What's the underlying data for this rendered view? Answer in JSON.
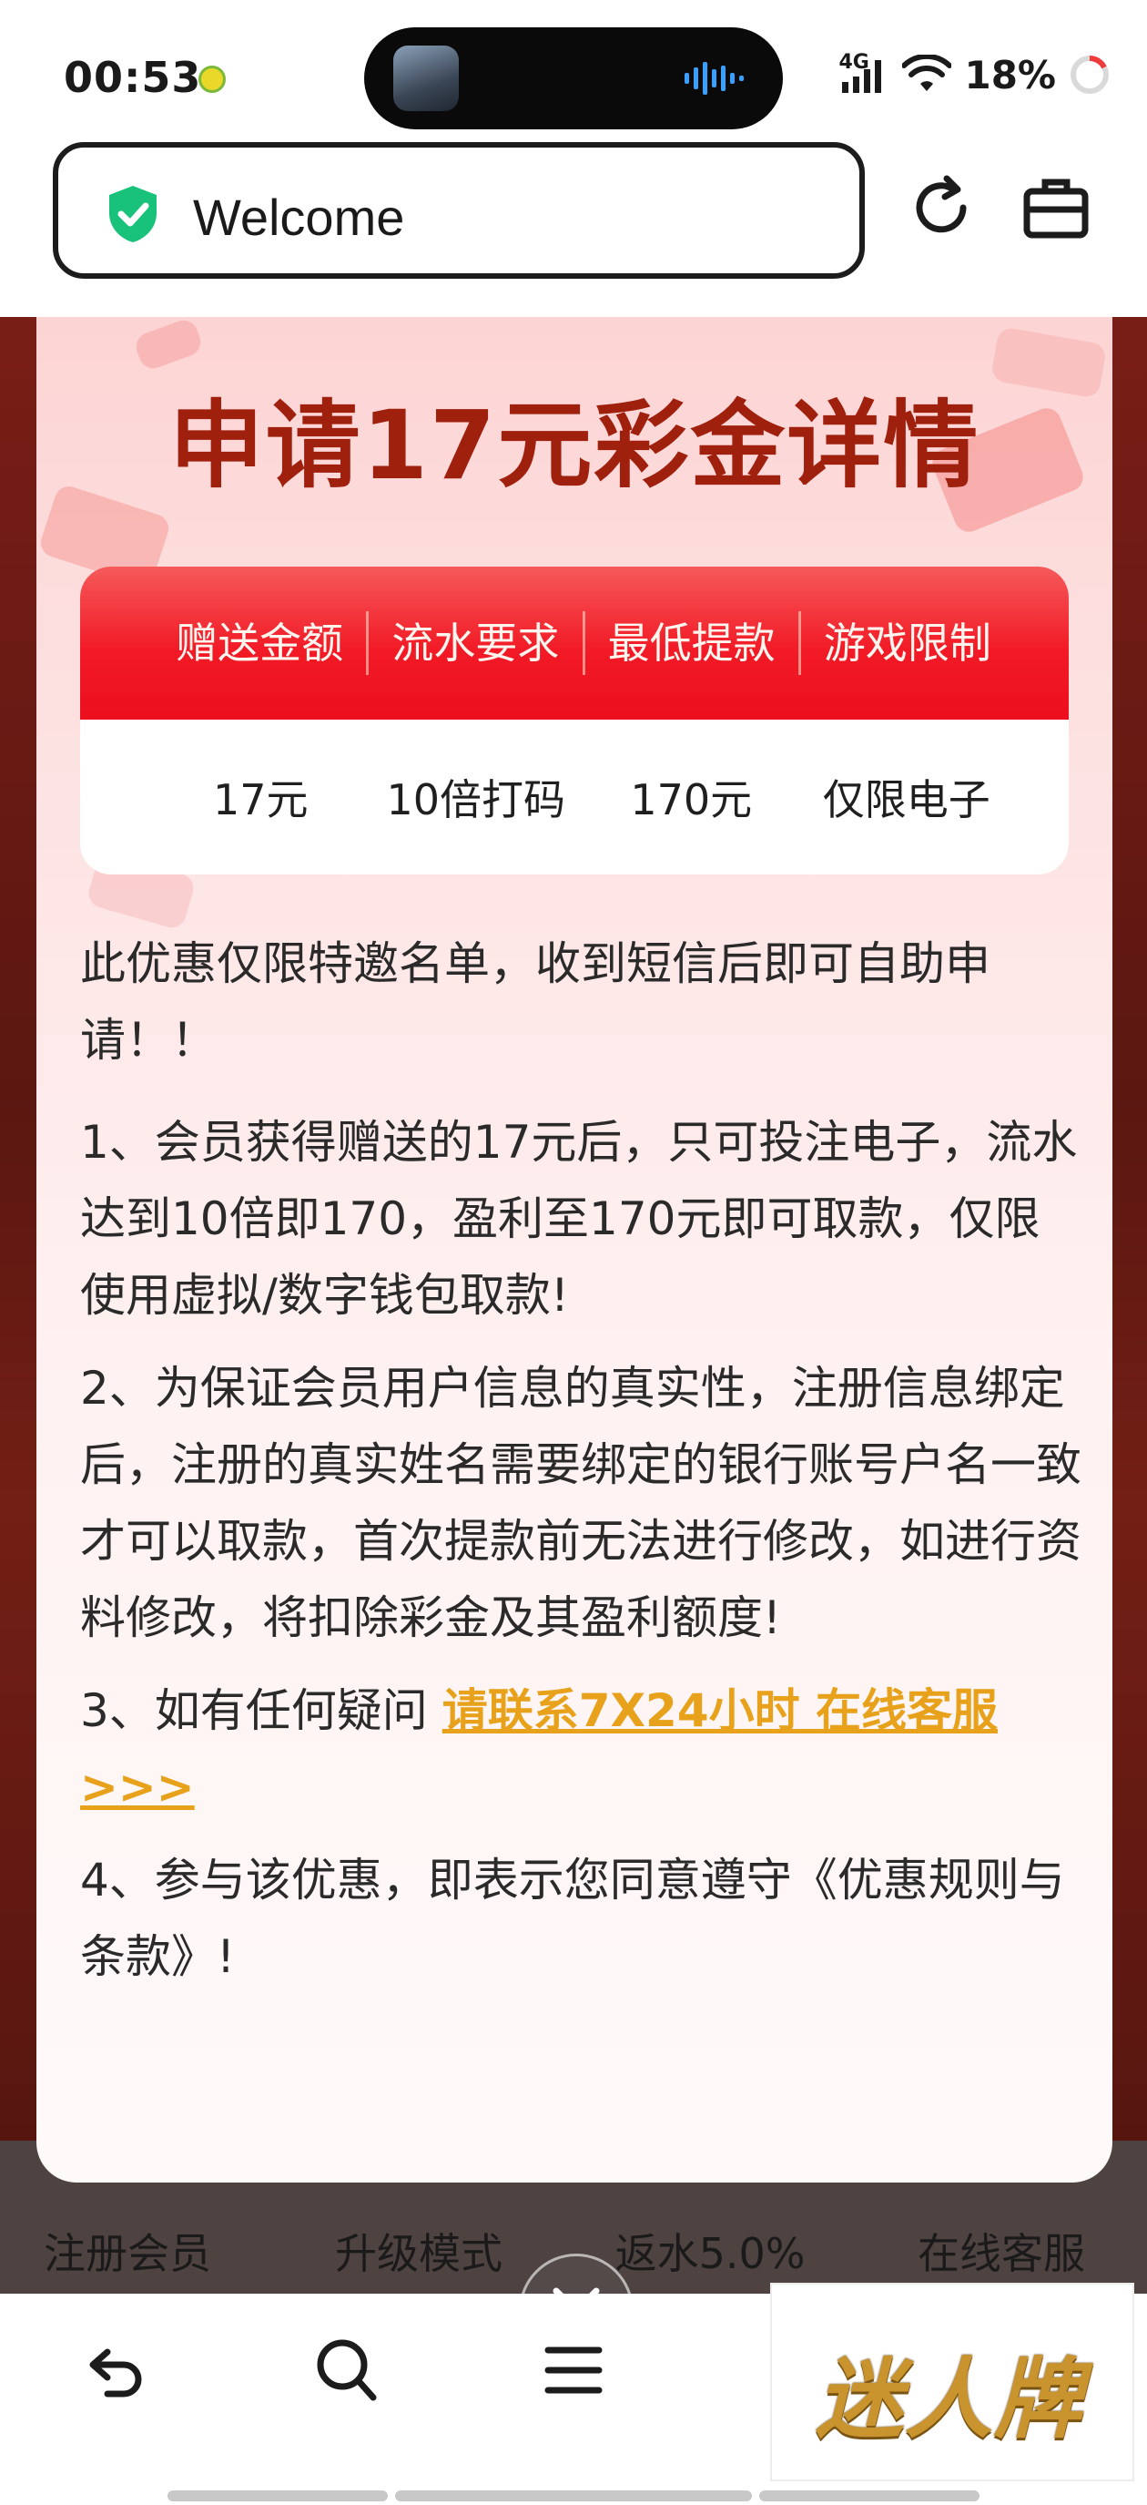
{
  "status_bar": {
    "time": "00:53",
    "network": "4G",
    "battery": "18%"
  },
  "browser": {
    "url_title": "Welcome"
  },
  "page_nav": {
    "items": [
      "注册会员",
      "升级模式",
      "返水5.0%",
      "在线客服"
    ]
  },
  "modal": {
    "title": "申请17元彩金详情",
    "table": {
      "headers": [
        "赠送金额",
        "流水要求",
        "最低提款",
        "游戏限制"
      ],
      "values": [
        "17元",
        "10倍打码",
        "170元",
        "仅限电子"
      ]
    },
    "intro": "此优惠仅限特邀名单，收到短信后即可自助申请！！",
    "rule1": "1、会员获得赠送的17元后，只可投注电子，流水达到10倍即170，盈利至170元即可取款，仅限使用虚拟/数字钱包取款!",
    "rule2": "2、为保证会员用户信息的真实性，注册信息绑定后，注册的真实姓名需要绑定的银行账号户名一致才可以取款，首次提款前无法进行修改，如进行资料修改，将扣除彩金及其盈利额度!",
    "rule3_prefix": "3、如有任何疑问 ",
    "rule3_link": "请联系7X24小时 在线客服 >>>",
    "rule4": "4、参与该优惠，即表示您同意遵守《优惠规则与条款》!"
  },
  "promo_badge": {
    "text": "迷人牌"
  },
  "colors": {
    "title_red": "#a0200e",
    "header_red": "#f21a26",
    "link_gold": "#e8a11a",
    "shield_green": "#18c27a"
  }
}
